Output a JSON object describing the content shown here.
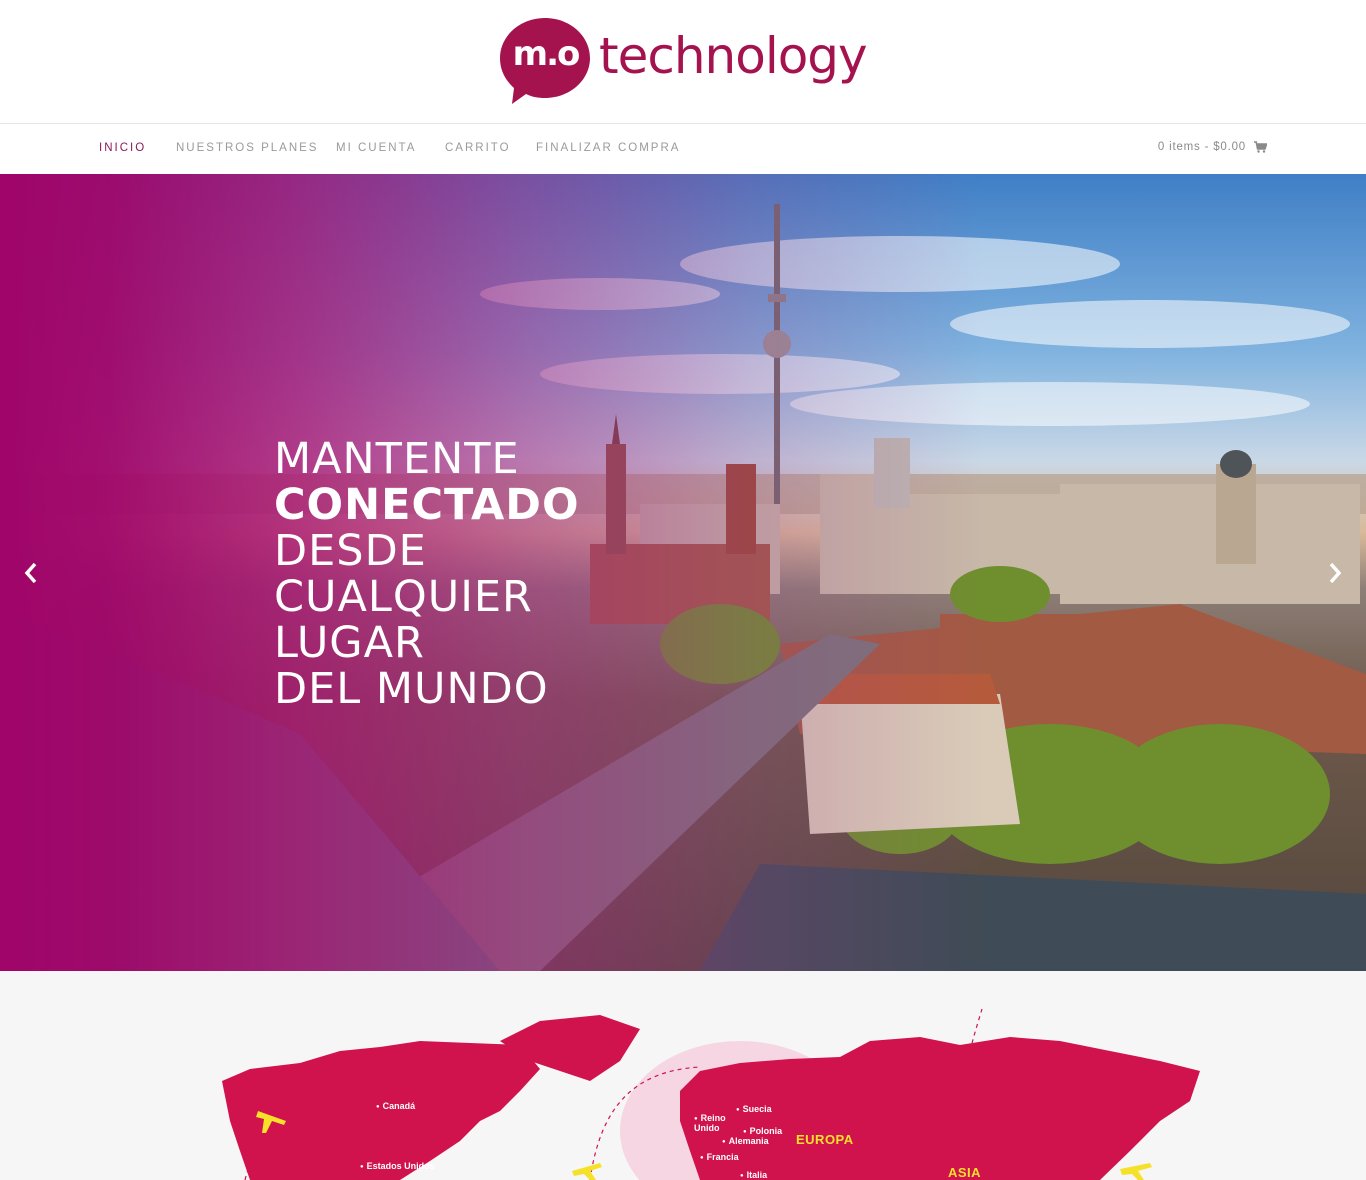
{
  "brand": {
    "mark": "m.o",
    "word": "technology",
    "color": "#a5134f"
  },
  "nav": {
    "items": [
      {
        "label": "INICIO",
        "active": true
      },
      {
        "label": "NUESTROS PLANES",
        "active": false
      },
      {
        "label": "MI CUENTA",
        "active": false
      },
      {
        "label": "CARRITO",
        "active": false
      },
      {
        "label": "FINALIZAR COMPRA",
        "active": false
      }
    ],
    "cart_label": "0 items - $0.00",
    "cart_icon": "shopping-cart-icon"
  },
  "hero": {
    "lines": [
      "MANTENTE",
      "CONECTADO",
      "DESDE",
      "CUALQUIER",
      "LUGAR",
      "DEL MUNDO"
    ],
    "prev_icon": "chevron-left-icon",
    "next_icon": "chevron-right-icon",
    "overlay_color": "#a00569"
  },
  "map": {
    "countries": [
      "Canadá",
      "Estados Unidos",
      "Reino Unido",
      "Suecia",
      "Polonia",
      "Alemania",
      "Francia",
      "Italia"
    ],
    "regions": [
      "EUROPA",
      "ASIA"
    ],
    "land_color": "#d0124d",
    "accent_color": "#f6e12a"
  }
}
